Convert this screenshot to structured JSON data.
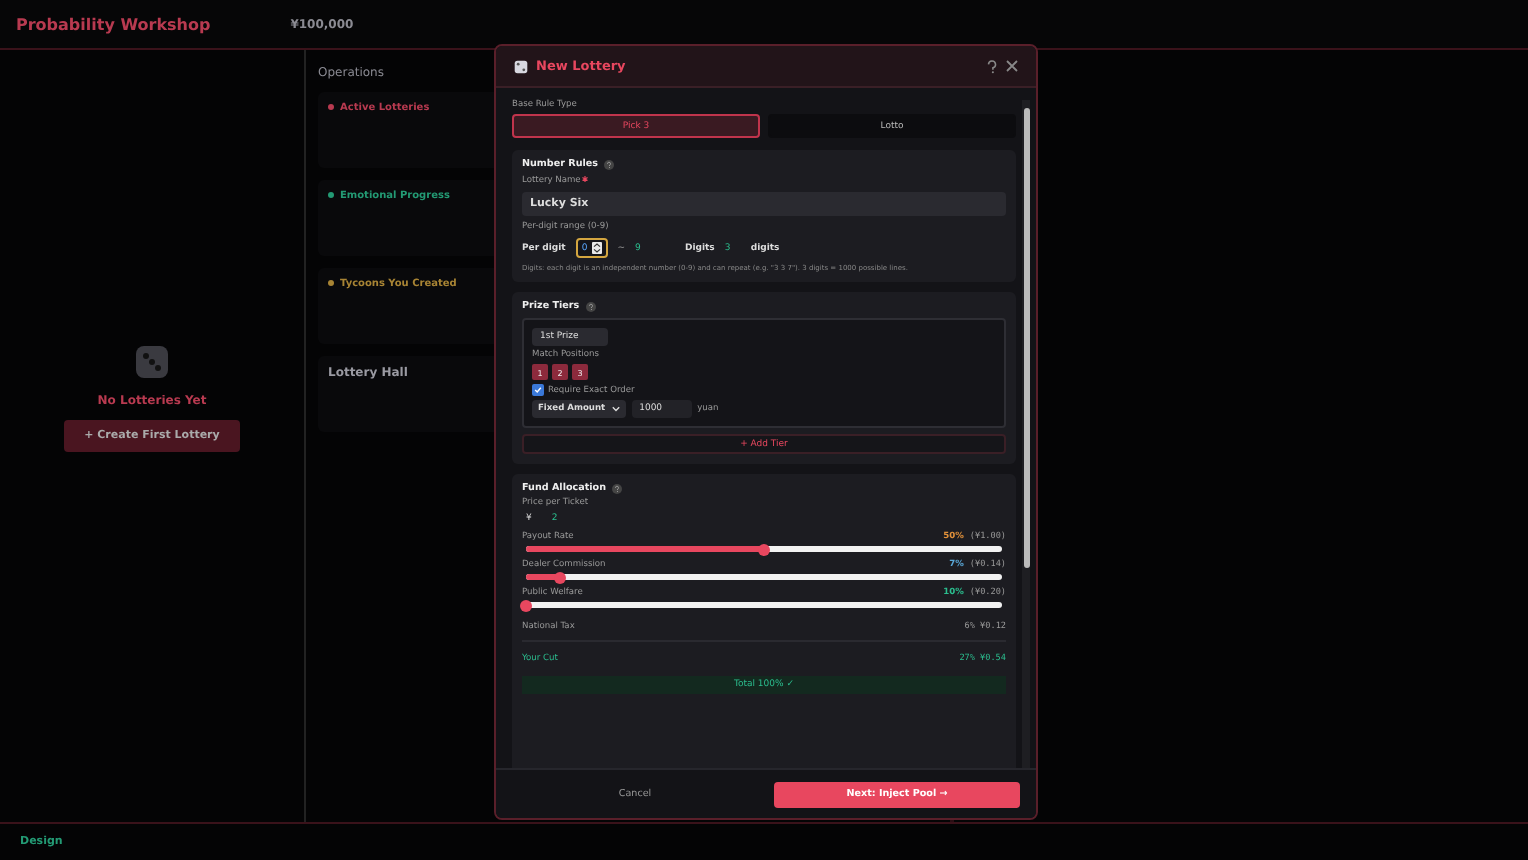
{
  "topbar": {
    "title": "Probability Workshop",
    "balance": "¥100,000"
  },
  "empty_state": {
    "title": "No Lotteries Yet",
    "button": "+ Create First Lottery"
  },
  "operations": {
    "title": "Operations",
    "sections": [
      {
        "title": "Active Lotteries",
        "color": "#b83a50"
      },
      {
        "title": "Emotional Progress",
        "color": "#239a74"
      },
      {
        "title": "Tycoons You Created",
        "color": "#a88434"
      }
    ],
    "hall": "Lottery Hall"
  },
  "statusbar": {
    "label": "Design"
  },
  "modal": {
    "title": "New Lottery",
    "rule_type": {
      "label": "Base Rule Type",
      "tabs": [
        {
          "label": "Pick 3",
          "selected": true
        },
        {
          "label": "Lotto",
          "selected": false
        }
      ]
    },
    "number_rules": {
      "title": "Number Rules",
      "name_label": "Lottery Name",
      "name_value": "Lucky Six",
      "range_label": "Per-digit range (0-9)",
      "per_digit_label": "Per digit",
      "min": "0",
      "tilde": "~",
      "max": "9",
      "digits_label": "Digits",
      "digits": "3",
      "digits_unit": "digits",
      "hint": "Digits: each digit is an independent number (0-9) and can repeat (e.g. \"3 3 7\"). 3 digits = 1000 possible lines."
    },
    "prize_tiers": {
      "title": "Prize Tiers",
      "tiers": [
        {
          "name": "1st Prize",
          "match_label": "Match Positions",
          "positions": [
            {
              "label": "1",
              "selected": true
            },
            {
              "label": "2",
              "selected": true
            },
            {
              "label": "3",
              "selected": true
            }
          ],
          "exact_order": {
            "label": "Require Exact Order",
            "checked": true
          },
          "amount_type": "Fixed Amount",
          "amount": "1000",
          "unit": "yuan"
        }
      ],
      "add_button": "+ Add Tier"
    },
    "fund": {
      "title": "Fund Allocation",
      "price_label": "Price per Ticket",
      "currency": "¥",
      "price": "2",
      "sliders": [
        {
          "label": "Payout Rate",
          "percent": "50%",
          "amount": "(¥1.00)",
          "level": 0.5,
          "color": "#e0903a"
        },
        {
          "label": "Dealer Commission",
          "percent": "7%",
          "amount": "(¥0.14)",
          "level": 0.07,
          "color": "#5aa8d8"
        },
        {
          "label": "Public Welfare",
          "percent": "10%",
          "amount": "(¥0.20)",
          "level": 0.0,
          "color": "#2bbd8e"
        }
      ],
      "tax": {
        "label": "National Tax",
        "value": "6% ¥0.12"
      },
      "cut": {
        "label": "Your Cut",
        "value": "27% ¥0.54"
      },
      "total": "Total 100% ✓"
    },
    "footer": {
      "cancel": "Cancel",
      "next": "Next: Inject Pool →"
    }
  }
}
